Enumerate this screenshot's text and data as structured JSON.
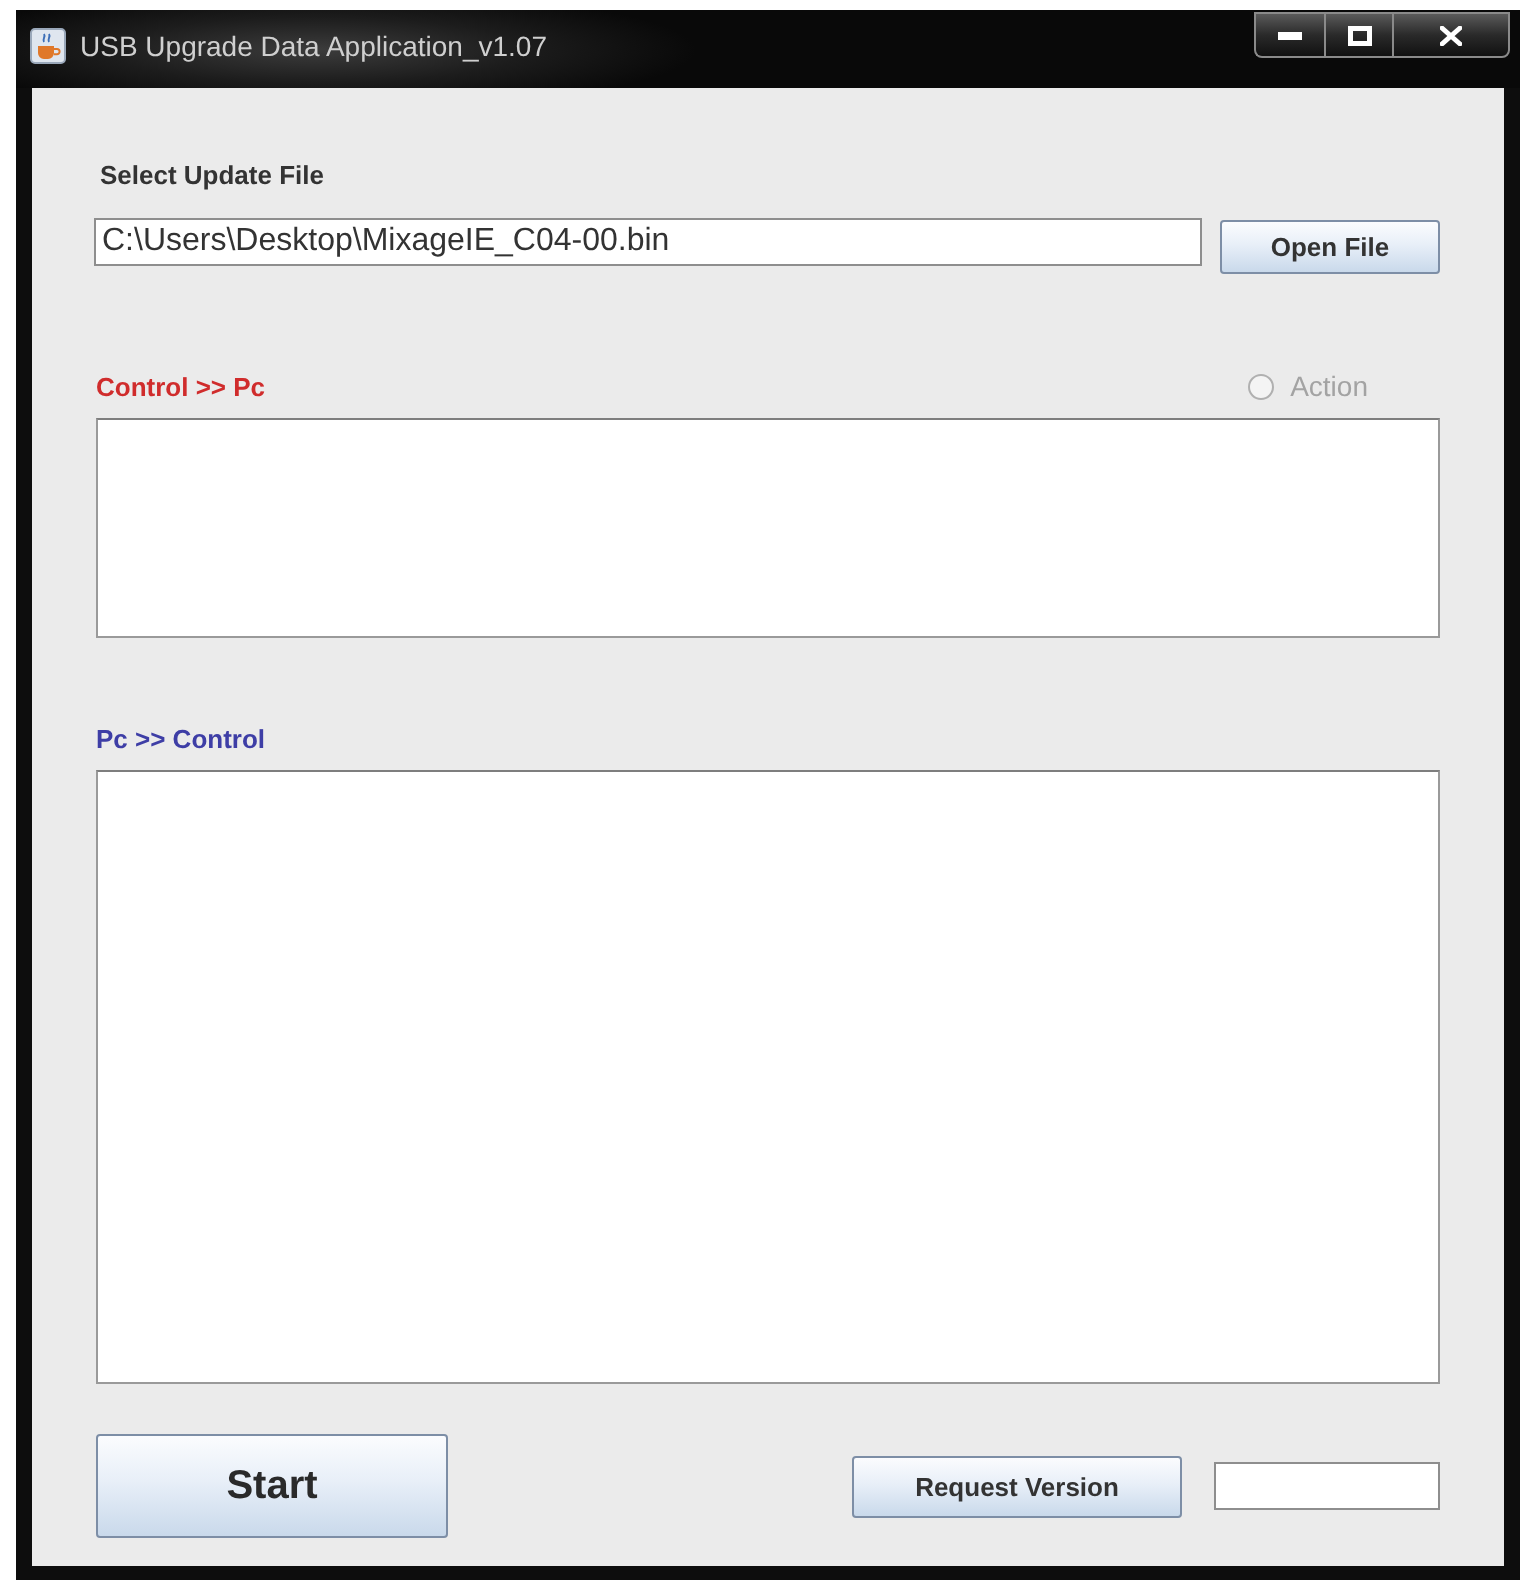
{
  "window": {
    "title": "USB Upgrade Data Application_v1.07"
  },
  "file_section": {
    "label": "Select Update File",
    "path_field": {
      "value": "C:\\Users\\Desktop\\MixageIE_C04-00.bin"
    },
    "button": "Open File"
  },
  "log_panels": [
    {
      "label": "Control >> Pc",
      "color": "#d02c2c",
      "radio": {
        "label": "Action",
        "selected": false,
        "disabled": true
      }
    },
    {
      "label": "Pc >> Control",
      "color": "#3e3ea6"
    }
  ],
  "footer": {
    "start_button": "Start",
    "request_button": "Request Version"
  }
}
